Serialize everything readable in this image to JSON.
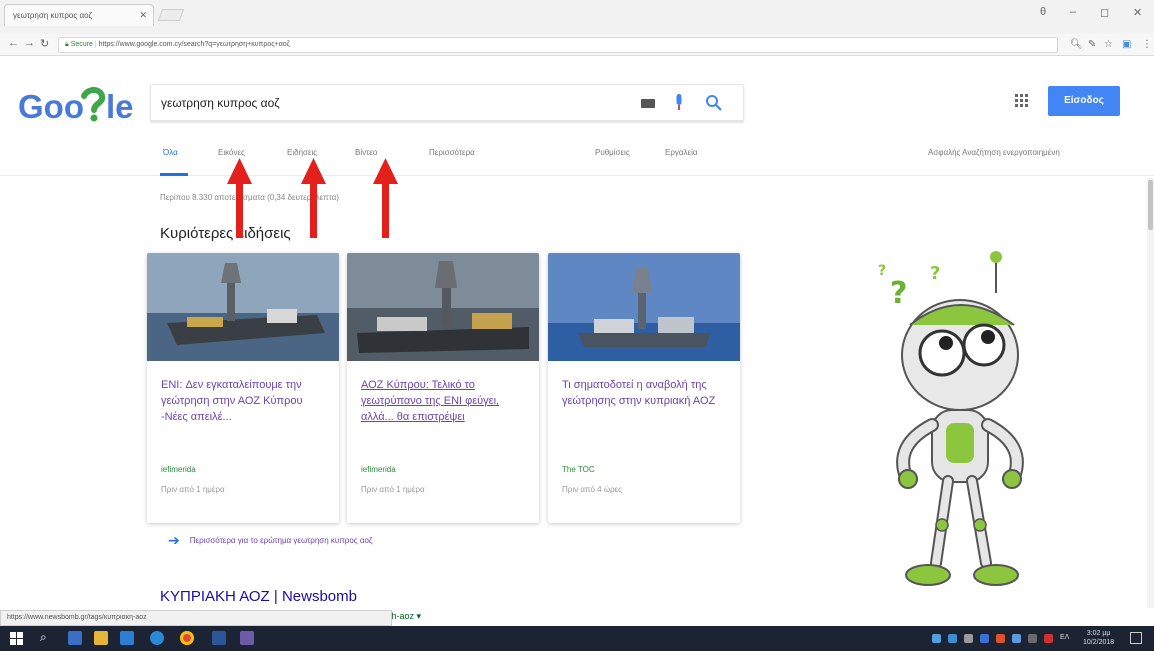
{
  "browser": {
    "tab_title": "γεωτρηση κυπρος αοζ",
    "secure_label": "Secure",
    "url": "https://www.google.com.cy/search?q=γεωτρηση+κυπρος+αοζ"
  },
  "search": {
    "logo_text": "Goo?le",
    "query": "γεωτρηση κυπρος αοζ",
    "signin_label": "Είσοδος"
  },
  "tabs": {
    "all": "Όλα",
    "images": "Εικόνες",
    "news": "Ειδήσεις",
    "videos": "Βίντεο",
    "more": "Περισσότερα",
    "settings": "Ρυθμίσεις",
    "tools": "Εργαλεία",
    "safesearch": "Ασφαλής Αναζήτηση ενεργοποιημένη"
  },
  "results_stats": "Περίπου 8.330 αποτελέσματα (0,34 δευτερόλεπτα)",
  "top_stories": {
    "title": "Κυριότερες ειδήσεις",
    "cards": [
      {
        "headline": "ENI: Δεν εγκαταλείπουμε την γεώτρηση στην ΑΟΖ Κύπρου -Νέες απειλέ...",
        "source": "iefimerida",
        "time": "Πριν από 1 ημέρα"
      },
      {
        "headline": "ΑΟΖ Κύπρου: Τελικό το γεωτρύπανο της ENI φεύγει, αλλά... θα επιστρέψει",
        "source": "iefimerida",
        "time": "Πριν από 1 ημέρα"
      },
      {
        "headline": "Τι σηματοδοτεί η αναβολή της γεώτρησης στην κυπριακή ΑΟΖ",
        "source": "The TOC",
        "time": "Πριν από 4 ώρες"
      }
    ],
    "more_link": "Περισσότερα για το ερώτημα γεωτρηση κυπρος αοζ"
  },
  "first_result": {
    "title": "ΚΥΠΡΙΑΚΗ ΑΟΖ | Newsbomb",
    "url": "iakh-aoz ▾"
  },
  "status_bar": "https://www.newsbomb.gr/tags/κυπριακη-aoz",
  "taskbar": {
    "time": "3:02 μμ",
    "date": "10/2/2018",
    "lang": "ΕΛ"
  },
  "colors": {
    "google_blue": "#4285f4",
    "link_purple": "#6a43b5",
    "arrow_red": "#e3201c"
  }
}
